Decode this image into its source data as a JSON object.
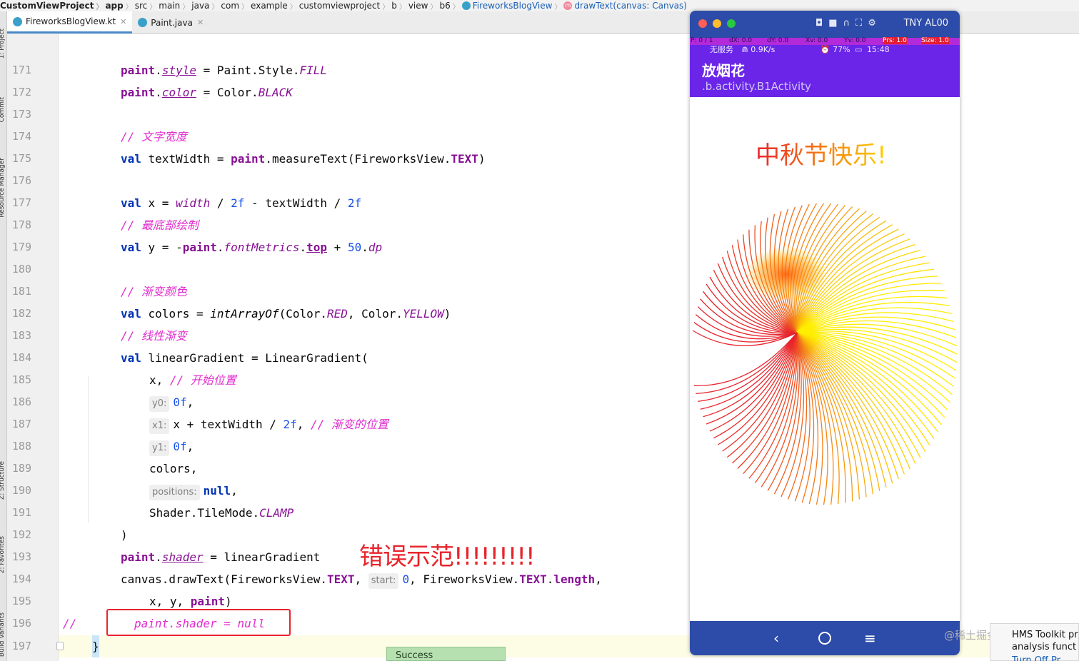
{
  "breadcrumbs": [
    "CustomViewProject",
    "app",
    "src",
    "main",
    "java",
    "com",
    "example",
    "customviewproject",
    "b",
    "view",
    "b6",
    "FireworksBlogView",
    "drawText(canvas: Canvas)"
  ],
  "tool_windows": {
    "project": "1: Project",
    "commit": "Commit",
    "resource": "Resource Manager",
    "structure": "Z: Structure",
    "favorites": "2: Favorites",
    "build_variants": "Build Variants"
  },
  "tabs": [
    {
      "label": "FireworksBlogView.kt",
      "icon": "kotlin-file-icon",
      "active": true
    },
    {
      "label": "Paint.java",
      "icon": "java-file-icon",
      "active": false
    }
  ],
  "line_numbers": [
    "171",
    "172",
    "173",
    "174",
    "175",
    "176",
    "177",
    "178",
    "179",
    "180",
    "181",
    "182",
    "183",
    "184",
    "185",
    "186",
    "187",
    "188",
    "189",
    "190",
    "191",
    "192",
    "193",
    "194",
    "195",
    "196",
    "197"
  ],
  "code": {
    "paint_kw": "paint",
    "style": "style",
    "fill": "Paint.Style.",
    "FILL": "FILL",
    "color": "color",
    "color_cls": "Color.",
    "BLACK": "BLACK",
    "cmt_text_width": "// 文字宽度",
    "val": "val",
    "textWidth": " textWidth = ",
    "measureText": ".measureText(FireworksView.",
    "TEXT": "TEXT",
    "close_paren": ")",
    "x_decl": " x = ",
    "width": "width",
    "div_2f": " / ",
    "n2f": "2f",
    "minus_tw": " - textWidth / ",
    "cmt_bottom": "// 最底部绘制",
    "y_decl": " y = -",
    "fontMetrics": "fontMetrics",
    "top": "top",
    "plus": " + ",
    "n50": "50",
    "dp": "dp",
    "cmt_gradient_color": "// 渐变颜色",
    "colors_decl": " colors = ",
    "intArrayOf": "intArrayOf",
    "open_color": "(Color.",
    "RED": "RED",
    "comma_color": ", Color.",
    "YELLOW": "YELLOW",
    "cmt_linear": "// 线性渐变",
    "lg_decl": " linearGradient = LinearGradient(",
    "x_arg": "x, ",
    "cmt_start": "// 开始位置",
    "hint_y0": "y0:",
    "n0f": "0f",
    "comma": ",",
    "hint_x1": "x1:",
    "x_plus": "x + textWidth / ",
    "cmt_pos": "// 渐变的位置",
    "hint_y1": "y1:",
    "colors_arg": "colors,",
    "hint_positions": "positions:",
    "null_kw": "null",
    "shader_mode": "Shader.TileMode.",
    "CLAMP": "CLAMP",
    "paren": ")",
    "shader": "shader",
    "assign_lg": " = linearGradient",
    "drawText": "canvas.drawText(FireworksView.",
    "comma_space": ", ",
    "hint_start": "start:",
    "n0": "0",
    "fv_text": ", FireworksView.",
    "length": "length",
    "xy_paint": "x, y, ",
    "commented_prefix": "//",
    "shader_null": "paint.shader = null",
    "brace": "}"
  },
  "annotation": "错误示范!!!!!!!!!",
  "status_popup": "Success",
  "emulator": {
    "device": "TNY AL00",
    "debug_bar": [
      "P: 0 / 1",
      "dX: 0.0",
      "dY: 0.0",
      "Xv: 0.0",
      "Yv: 0.0",
      "Prs: 1.0",
      "Size: 1.0"
    ],
    "status_left": "无服务",
    "status_speed": "0.9K/s",
    "status_battery": "77%",
    "status_time": "15:48",
    "app_title": "放烟花",
    "app_subtitle": ".b.activity.B1Activity",
    "canvas_text": "中秋节快乐!",
    "colors": {
      "appbar": "#6a25e8",
      "frame": "#2d4ba8",
      "red": "#e8242c",
      "yellow": "#ffff00"
    }
  },
  "watermark": "@稀土掘金技术社区",
  "hms_popup": {
    "line1": "HMS Toolkit pr",
    "line2": "analysis funct",
    "line3": "Turn Off Pr"
  }
}
